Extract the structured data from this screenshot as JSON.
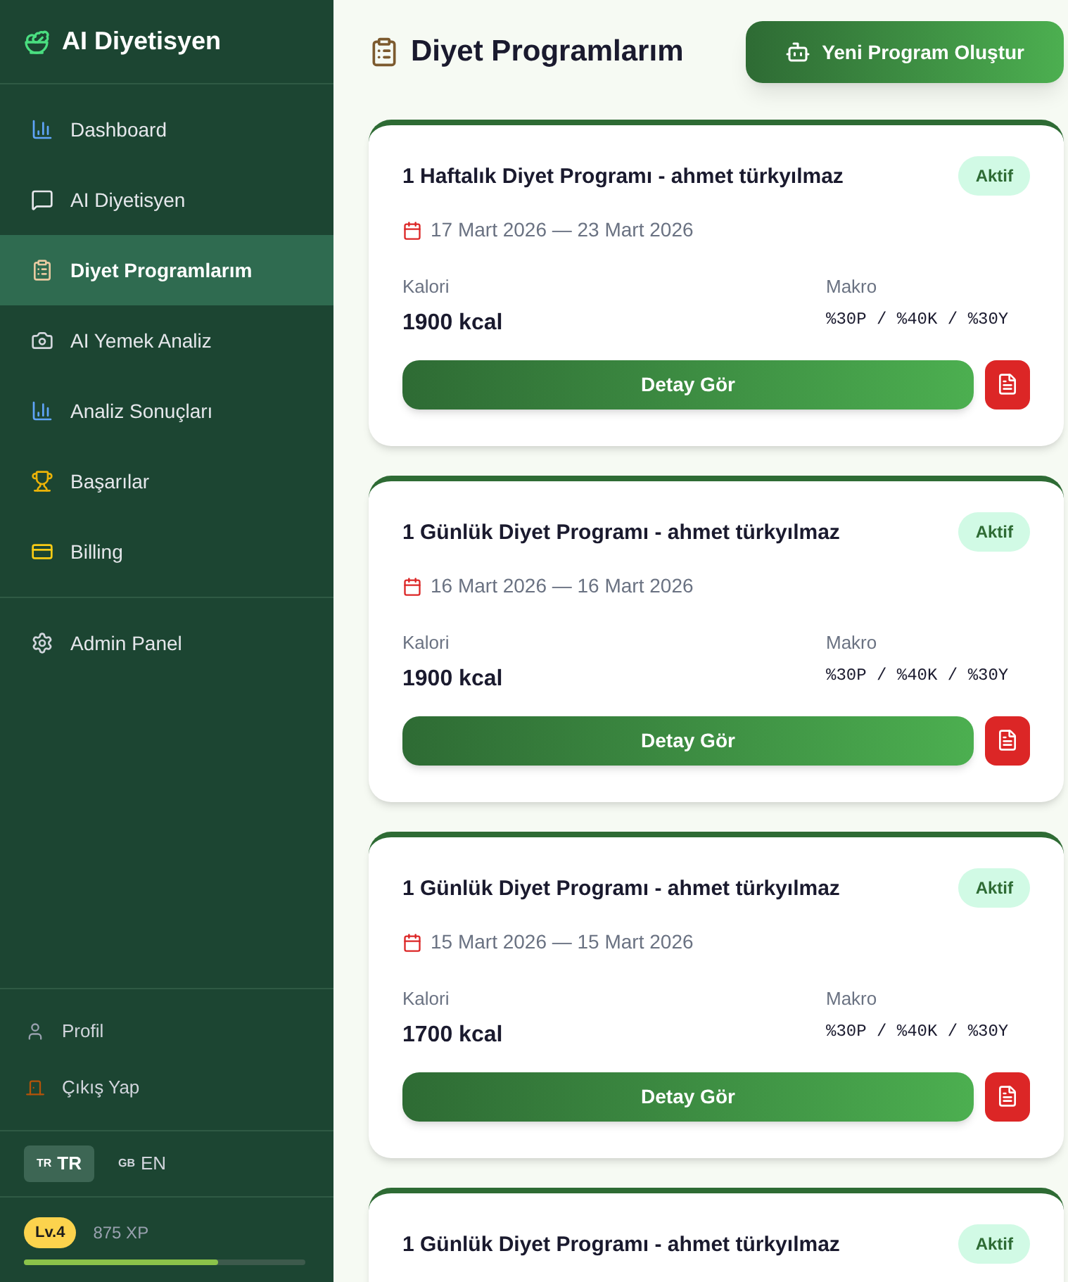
{
  "sidebar": {
    "brand": "AI Diyetisyen",
    "items": [
      {
        "label": "Dashboard",
        "kind": "chart",
        "selected": false
      },
      {
        "label": "AI Diyetisyen",
        "kind": "chat",
        "selected": false
      },
      {
        "label": "Diyet Programlarım",
        "kind": "clipboard",
        "selected": true
      },
      {
        "label": "AI Yemek Analiz",
        "kind": "camera",
        "selected": false
      },
      {
        "label": "Analiz Sonuçları",
        "kind": "chart",
        "selected": false
      },
      {
        "label": "Başarılar",
        "kind": "trophy",
        "selected": false
      },
      {
        "label": "Billing",
        "kind": "card",
        "selected": false
      }
    ],
    "admin_items": [
      {
        "label": "Admin Panel",
        "kind": "gear",
        "selected": false
      }
    ],
    "footer_items": [
      {
        "label": "Profil",
        "kind": "user"
      },
      {
        "label": "Çıkış Yap",
        "kind": "door"
      }
    ],
    "languages": [
      {
        "flag": "TR",
        "label": "TR",
        "selected": true
      },
      {
        "flag": "GB",
        "label": "EN",
        "selected": false
      }
    ],
    "level": {
      "badge": "Lv.4",
      "xp": "875 XP",
      "level": 0.69
    }
  },
  "page": {
    "title": "Diyet Programlarım",
    "new_button": "Yeni Program Oluştur"
  },
  "programs": [
    {
      "title": "1 Haftalık Diyet Programı - ahmet türkyılmaz",
      "status": "Aktif",
      "dates": "17 Mart 2026 — 23 Mart 2026",
      "calorie_label": "Kalori",
      "calorie": "1900 kcal",
      "macro_label": "Makro",
      "macro": "%30P / %40K / %30Y",
      "detail_button": "Detay Gör"
    },
    {
      "title": "1 Günlük Diyet Programı - ahmet türkyılmaz",
      "status": "Aktif",
      "dates": "16 Mart 2026 — 16 Mart 2026",
      "calorie_label": "Kalori",
      "calorie": "1900 kcal",
      "macro_label": "Makro",
      "macro": "%30P / %40K / %30Y",
      "detail_button": "Detay Gör"
    },
    {
      "title": "1 Günlük Diyet Programı - ahmet türkyılmaz",
      "status": "Aktif",
      "dates": "15 Mart 2026 — 15 Mart 2026",
      "calorie_label": "Kalori",
      "calorie": "1700 kcal",
      "macro_label": "Makro",
      "macro": "%30P / %40K / %30Y",
      "detail_button": "Detay Gör"
    },
    {
      "title": "1 Günlük Diyet Programı - ahmet türkyılmaz",
      "status": "Aktif"
    }
  ]
}
